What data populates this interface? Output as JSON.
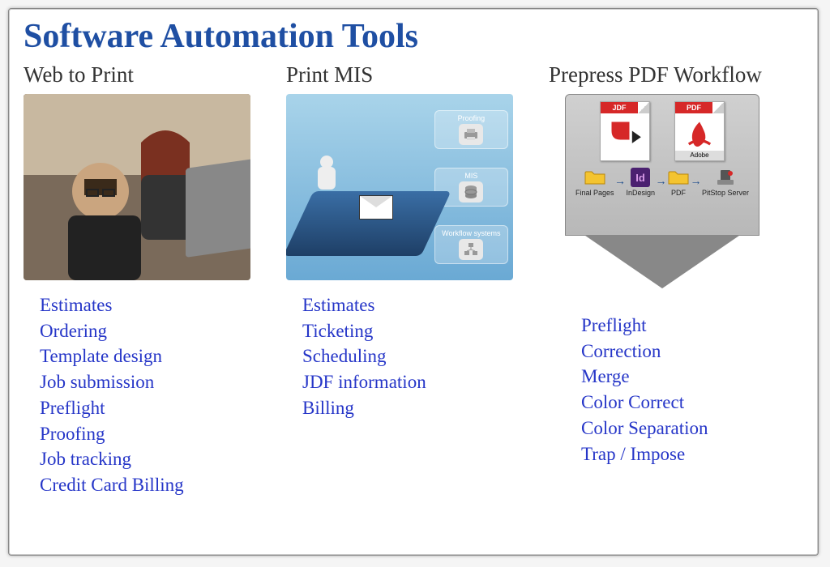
{
  "title": "Software Automation Tools",
  "columns": [
    {
      "heading": "Web to Print",
      "image_alt": "Two people looking at a computer screen",
      "items": [
        "Estimates",
        "Ordering",
        "Template design",
        "Job submission",
        "Preflight",
        "Proofing",
        "Job tracking",
        "Credit Card Billing"
      ]
    },
    {
      "heading": "Print MIS",
      "image_alt": "Robot on conveyor sending to Proofing, MIS, Workflow systems",
      "mis_boxes": [
        "Proofing",
        "MIS",
        "Workflow systems"
      ],
      "items": [
        "Estimates",
        "Ticketing",
        "Scheduling",
        "JDF information",
        "Billing"
      ]
    },
    {
      "heading": "Prepress PDF Workflow",
      "image_alt": "JDF and PDF documents flowing through Final Pages, InDesign, PDF, PitStop Server",
      "doc_labels": {
        "jdf": "JDF",
        "pdf": "PDF",
        "adobe": "Adobe"
      },
      "workflow_steps": [
        "Final Pages",
        "InDesign",
        "PDF",
        "PitStop Server"
      ],
      "items": [
        "Preflight",
        "Correction",
        "Merge",
        "Color Correct",
        "Color Separation",
        "Trap / Impose"
      ]
    }
  ]
}
